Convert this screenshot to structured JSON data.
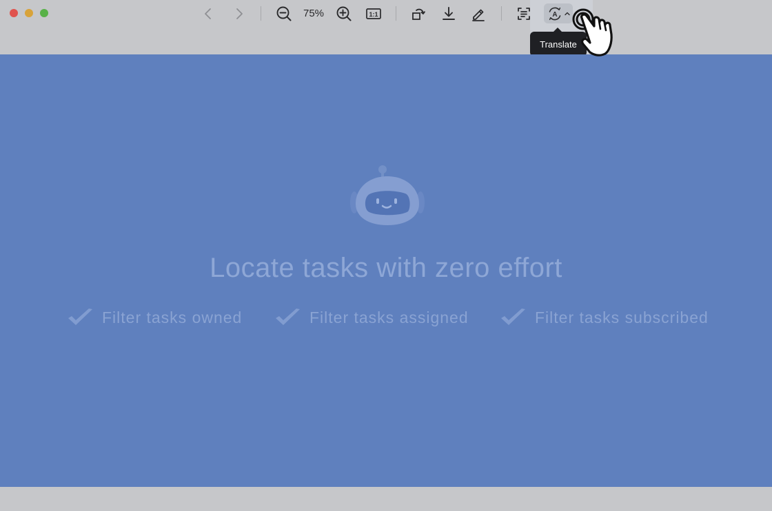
{
  "window": {
    "traffic_lights": [
      {
        "name": "close",
        "color": "#e0534e"
      },
      {
        "name": "minimize",
        "color": "#d8a33a"
      },
      {
        "name": "zoom",
        "color": "#58b148"
      }
    ]
  },
  "toolbar": {
    "icons": {
      "back": "chevron-left-icon",
      "forward": "chevron-right-icon",
      "zoom_out": "zoom-out-icon",
      "zoom_in": "zoom-in-icon",
      "actual_size": "actual-size-icon",
      "rotate": "rotate-icon",
      "download": "download-icon",
      "annotate": "pen-icon",
      "extract_text": "scan-text-icon",
      "translate": "translate-icon"
    },
    "zoom_level": "75%",
    "actual_size_label": "1:1",
    "translate_glyph": "A",
    "tooltip": "Translate"
  },
  "content": {
    "headline": "Locate tasks with zero effort",
    "features": [
      {
        "label": "Filter tasks owned"
      },
      {
        "label": "Filter tasks assigned"
      },
      {
        "label": "Filter tasks subscribed"
      }
    ]
  },
  "colors": {
    "chrome": "#c6c7ca",
    "overlay": "#5f80be",
    "tooltip_bg": "#1f2024",
    "muted_text": "#8ea7d6"
  }
}
